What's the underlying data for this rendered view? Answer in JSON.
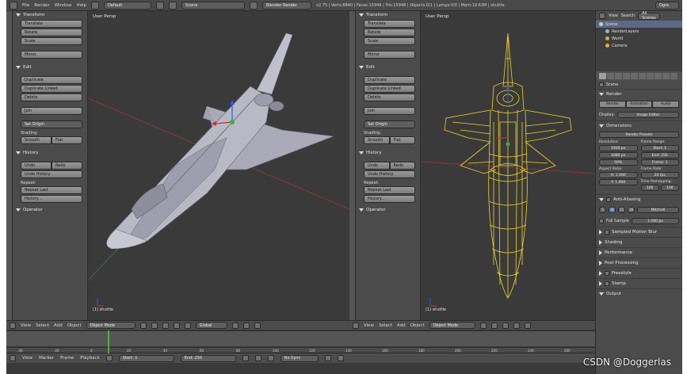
{
  "topbar": {
    "menus": [
      "File",
      "Render",
      "Window",
      "Help"
    ],
    "layout": "Default",
    "scene": "Scene",
    "engine": "Blender Render",
    "stats": "v2.75 | Verts:8840 | Faces:15948 | Tris:15948 | Objects:0/1 | Lamps:0/0 | Mem:19.63M | shuttle",
    "search_label": "Ogre"
  },
  "left_shelf": {
    "transform": "Transform",
    "translate": "Translate",
    "rotate": "Rotate",
    "scale": "Scale",
    "mirror": "Mirror",
    "edit": "Edit",
    "duplicate": "Duplicate",
    "duplicate_linked": "Duplicate Linked",
    "delete": "Delete",
    "join": "Join",
    "set_origin": "Set Origin",
    "shading": "Shading:",
    "smooth": "Smooth",
    "flat": "Flat",
    "history": "History",
    "undo": "Undo",
    "redo": "Redo",
    "undo_history": "Undo History",
    "repeat": "Repeat:",
    "repeat_last": "Repeat Last",
    "history_btn": "History...",
    "operator": "Operator"
  },
  "viewport_left": {
    "title": "User Persp",
    "object": "(1) shuttle"
  },
  "viewport_right": {
    "title": "User Persp",
    "object": "(1) shuttle"
  },
  "view_header": {
    "view": "View",
    "select": "Select",
    "add": "Add",
    "object": "Object",
    "mode": "Object Mode",
    "pivot": "Global"
  },
  "timeline_header": {
    "view": "View",
    "marker": "Marker",
    "frame": "Frame",
    "playback": "Playback",
    "start": "Start: 1",
    "end": "End: 250",
    "sync": "No Sync"
  },
  "ruler_ticks": [
    "-40",
    "-20",
    "0",
    "20",
    "40",
    "60",
    "80",
    "100",
    "120",
    "140",
    "160",
    "180",
    "200",
    "220",
    "240",
    "260"
  ],
  "outliner": {
    "view": "View",
    "search": "Search",
    "all_scenes": "All Scenes",
    "rows": [
      "Scene",
      "RenderLayers",
      "World",
      "Camera"
    ]
  },
  "properties": {
    "scene_label": "Scene",
    "render": "Render",
    "render_btn": "Render",
    "animation_btn": "Animation",
    "audio_btn": "Audio",
    "display_label": "Display:",
    "display_value": "Image Editor",
    "dimensions": "Dimensions",
    "presets": "Render Presets",
    "resolution": "Resolution:",
    "res_x": "1920 px",
    "res_y": "1080 px",
    "res_pct": "50%",
    "frame_range": "Frame Range:",
    "start_frame": "Start: 1",
    "end_frame": "End: 250",
    "frame_step": "Frame: 1",
    "aspect": "Aspect Ratio:",
    "aspect_x": "X: 1.000",
    "aspect_y": "Y: 1.000",
    "frame_rate": "Frame Rate:",
    "fps": "24 fps",
    "time_remap": "Time Remapping:",
    "remap_old": "100",
    "remap_new": "100",
    "anti_aliasing": "Anti-Aliasing",
    "aa_samples": [
      "5",
      "8",
      "11",
      "16"
    ],
    "aa_filter": "Mitchell",
    "full_sample": "Full Sample",
    "filter_size": "1.000 px",
    "sampled_motion_blur": "Sampled Motion Blur",
    "shading": "Shading",
    "performance": "Performance",
    "post_processing": "Post Processing",
    "freestyle": "Freestyle",
    "stamp": "Stamp",
    "output": "Output"
  },
  "watermark": "CSDN @Doggerlas",
  "colors": {
    "wire": "#f2d22a",
    "mesh": "#b9b9c6",
    "bg": "#3a3a3a"
  }
}
